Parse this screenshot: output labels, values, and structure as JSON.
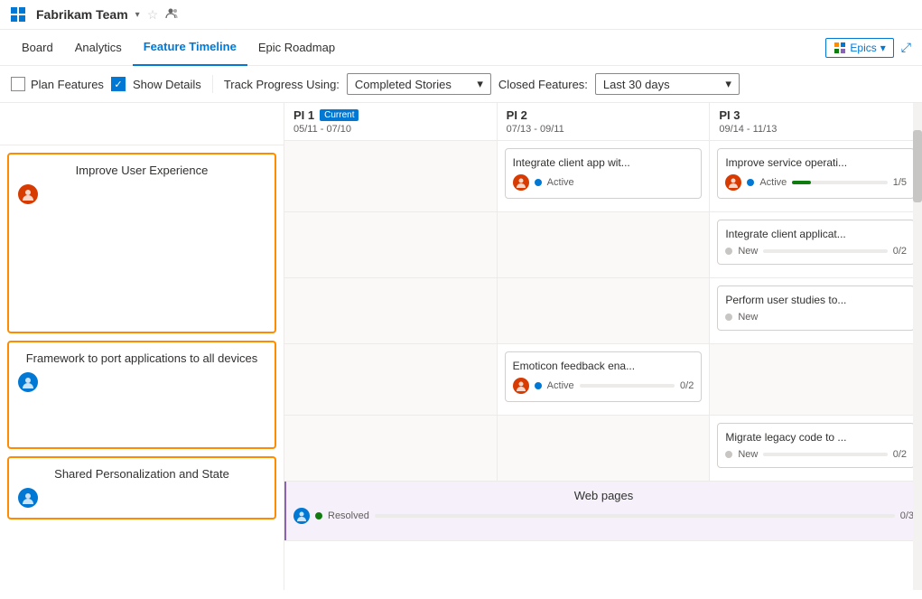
{
  "app": {
    "grid_icon": "app-grid",
    "team_name": "Fabrikam Team",
    "chevron": "▾",
    "star": "☆",
    "people": "⚇"
  },
  "nav": {
    "items": [
      {
        "id": "board",
        "label": "Board",
        "active": false
      },
      {
        "id": "analytics",
        "label": "Analytics",
        "active": false
      },
      {
        "id": "feature-timeline",
        "label": "Feature Timeline",
        "active": true
      },
      {
        "id": "epic-roadmap",
        "label": "Epic Roadmap",
        "active": false
      }
    ],
    "epics_label": "Epics",
    "expand_icon": "⤢"
  },
  "toolbar": {
    "plan_features_label": "Plan Features",
    "show_details_label": "Show Details",
    "track_progress_label": "Track Progress Using:",
    "completed_stories_label": "Completed Stories",
    "closed_features_label": "Closed Features:",
    "last_30_days_label": "Last 30 days"
  },
  "pis": [
    {
      "id": "pi1",
      "label": "PI 1",
      "current": true,
      "badge": "Current",
      "dates": "05/11 - 07/10"
    },
    {
      "id": "pi2",
      "label": "PI 2",
      "current": false,
      "dates": "07/13 - 09/11"
    },
    {
      "id": "pi3",
      "label": "PI 3",
      "current": false,
      "dates": "09/14 - 11/13"
    }
  ],
  "epics": [
    {
      "id": "epic1",
      "title": "Improve User Experience",
      "avatar_label": "U",
      "rows": [
        {
          "pi1": null,
          "pi2": {
            "title": "Integrate client app wit...",
            "status": "active",
            "status_label": "Active",
            "progress": 0,
            "total": null
          },
          "pi3": {
            "title": "Improve service operati...",
            "status": "active",
            "status_label": "Active",
            "progress": 20,
            "count": "1/5"
          }
        },
        {
          "pi1": null,
          "pi2": null,
          "pi3": {
            "title": "Integrate client applicat...",
            "status": "new",
            "status_label": "New",
            "progress": 0,
            "count": "0/2"
          }
        },
        {
          "pi1": null,
          "pi2": null,
          "pi3": {
            "title": "Perform user studies to...",
            "status": "new",
            "status_label": "New",
            "progress": 0,
            "count": null
          }
        }
      ]
    },
    {
      "id": "epic2",
      "title": "Framework to port applications to all devices",
      "avatar_label": "F",
      "rows": [
        {
          "pi1": null,
          "pi2": {
            "title": "Emoticon feedback ena...",
            "status": "active",
            "status_label": "Active",
            "progress": 0,
            "count": "0/2"
          },
          "pi3": null
        },
        {
          "pi1": null,
          "pi2": null,
          "pi3": {
            "title": "Migrate legacy code to ...",
            "status": "new",
            "status_label": "New",
            "progress": 0,
            "count": "0/2"
          }
        }
      ]
    },
    {
      "id": "epic3",
      "title": "Shared Personalization and State",
      "avatar_label": "S",
      "rows": [
        {
          "span": true,
          "title": "Web pages",
          "status": "resolved",
          "status_label": "Resolved",
          "progress": 0,
          "count": "0/3"
        }
      ]
    }
  ]
}
